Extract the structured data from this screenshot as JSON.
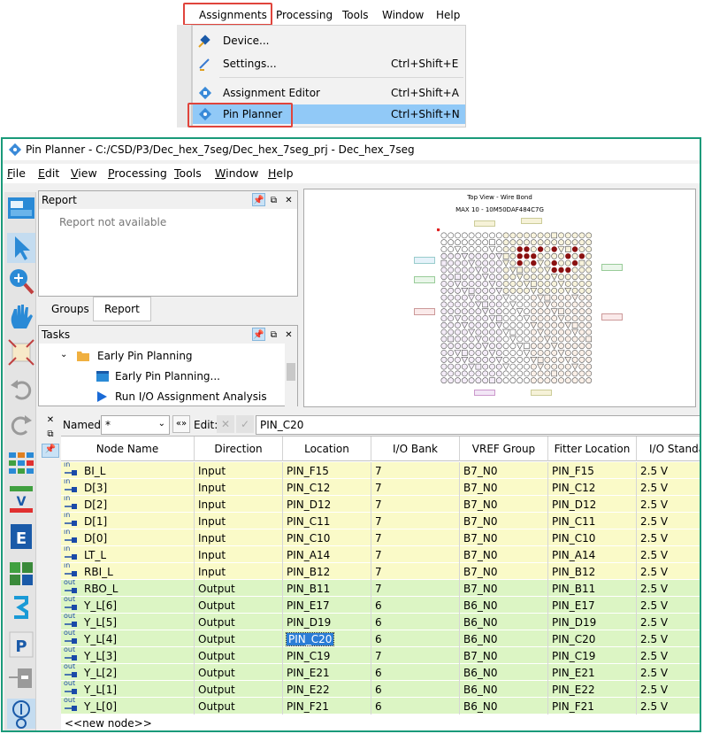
{
  "main_menu": {
    "items": [
      "Assignments",
      "Processing",
      "Tools",
      "Window",
      "Help"
    ],
    "dropdown": [
      {
        "label": "Device...",
        "shortcut": "",
        "icon": "device-icon"
      },
      {
        "label": "Settings...",
        "shortcut": "Ctrl+Shift+E",
        "icon": "settings-icon"
      },
      {
        "label": "Assignment Editor",
        "shortcut": "Ctrl+Shift+A",
        "icon": "assignment-editor-icon"
      },
      {
        "label": "Pin Planner",
        "shortcut": "Ctrl+Shift+N",
        "icon": "pin-planner-icon"
      }
    ]
  },
  "window": {
    "title": "Pin Planner - C:/CSD/P3/Dec_hex_7seg/Dec_hex_7seg_prj - Dec_hex_7seg",
    "menu": [
      "File",
      "Edit",
      "View",
      "Processing",
      "Tools",
      "Window",
      "Help"
    ]
  },
  "report": {
    "title": "Report",
    "empty_text": "Report not available",
    "tabs": [
      "Groups",
      "Report"
    ]
  },
  "tasks": {
    "title": "Tasks",
    "items": [
      "Early Pin Planning",
      "Early Pin Planning...",
      "Run I/O Assignment Analysis"
    ]
  },
  "floorplan": {
    "title": "Top View - Wire Bond",
    "subtitle": "MAX 10 - 10M50DAF484C7G"
  },
  "grid_toolbar": {
    "named_label": "Named:",
    "named_value": "*",
    "edit_label": "Edit:",
    "edit_value": "PIN_C20"
  },
  "table": {
    "headers": [
      "Node Name",
      "Direction",
      "Location",
      "I/O Bank",
      "VREF Group",
      "Fitter Location",
      "I/O Standard"
    ],
    "rows": [
      {
        "dir_tag": "in",
        "name": "BI_L",
        "direction": "Input",
        "location": "PIN_F15",
        "bank": "7",
        "vref": "B7_N0",
        "fitter": "PIN_F15",
        "std": "2.5 V"
      },
      {
        "dir_tag": "in",
        "name": "D[3]",
        "direction": "Input",
        "location": "PIN_C12",
        "bank": "7",
        "vref": "B7_N0",
        "fitter": "PIN_C12",
        "std": "2.5 V"
      },
      {
        "dir_tag": "in",
        "name": "D[2]",
        "direction": "Input",
        "location": "PIN_D12",
        "bank": "7",
        "vref": "B7_N0",
        "fitter": "PIN_D12",
        "std": "2.5 V"
      },
      {
        "dir_tag": "in",
        "name": "D[1]",
        "direction": "Input",
        "location": "PIN_C11",
        "bank": "7",
        "vref": "B7_N0",
        "fitter": "PIN_C11",
        "std": "2.5 V"
      },
      {
        "dir_tag": "in",
        "name": "D[0]",
        "direction": "Input",
        "location": "PIN_C10",
        "bank": "7",
        "vref": "B7_N0",
        "fitter": "PIN_C10",
        "std": "2.5 V"
      },
      {
        "dir_tag": "in",
        "name": "LT_L",
        "direction": "Input",
        "location": "PIN_A14",
        "bank": "7",
        "vref": "B7_N0",
        "fitter": "PIN_A14",
        "std": "2.5 V"
      },
      {
        "dir_tag": "in",
        "name": "RBI_L",
        "direction": "Input",
        "location": "PIN_B12",
        "bank": "7",
        "vref": "B7_N0",
        "fitter": "PIN_B12",
        "std": "2.5 V"
      },
      {
        "dir_tag": "out",
        "name": "RBO_L",
        "direction": "Output",
        "location": "PIN_B11",
        "bank": "7",
        "vref": "B7_N0",
        "fitter": "PIN_B11",
        "std": "2.5 V"
      },
      {
        "dir_tag": "out",
        "name": "Y_L[6]",
        "direction": "Output",
        "location": "PIN_E17",
        "bank": "6",
        "vref": "B6_N0",
        "fitter": "PIN_E17",
        "std": "2.5 V"
      },
      {
        "dir_tag": "out",
        "name": "Y_L[5]",
        "direction": "Output",
        "location": "PIN_D19",
        "bank": "6",
        "vref": "B6_N0",
        "fitter": "PIN_D19",
        "std": "2.5 V"
      },
      {
        "dir_tag": "out",
        "name": "Y_L[4]",
        "direction": "Output",
        "location": "PIN_C20",
        "bank": "6",
        "vref": "B6_N0",
        "fitter": "PIN_C20",
        "std": "2.5 V",
        "selected": true
      },
      {
        "dir_tag": "out",
        "name": "Y_L[3]",
        "direction": "Output",
        "location": "PIN_C19",
        "bank": "7",
        "vref": "B7_N0",
        "fitter": "PIN_C19",
        "std": "2.5 V"
      },
      {
        "dir_tag": "out",
        "name": "Y_L[2]",
        "direction": "Output",
        "location": "PIN_E21",
        "bank": "6",
        "vref": "B6_N0",
        "fitter": "PIN_E21",
        "std": "2.5 V"
      },
      {
        "dir_tag": "out",
        "name": "Y_L[1]",
        "direction": "Output",
        "location": "PIN_E22",
        "bank": "6",
        "vref": "B6_N0",
        "fitter": "PIN_E22",
        "std": "2.5 V"
      },
      {
        "dir_tag": "out",
        "name": "Y_L[0]",
        "direction": "Output",
        "location": "PIN_F21",
        "bank": "6",
        "vref": "B6_N0",
        "fitter": "PIN_F21",
        "std": "2.5 V"
      }
    ],
    "new_node": "<<new node>>"
  },
  "colors": {
    "input_row": "#fafac8",
    "output_row": "#dcf5c4",
    "highlight_border": "#e0443c",
    "window_border": "#1a9a7a",
    "menu_highlight": "#91c9f7"
  }
}
